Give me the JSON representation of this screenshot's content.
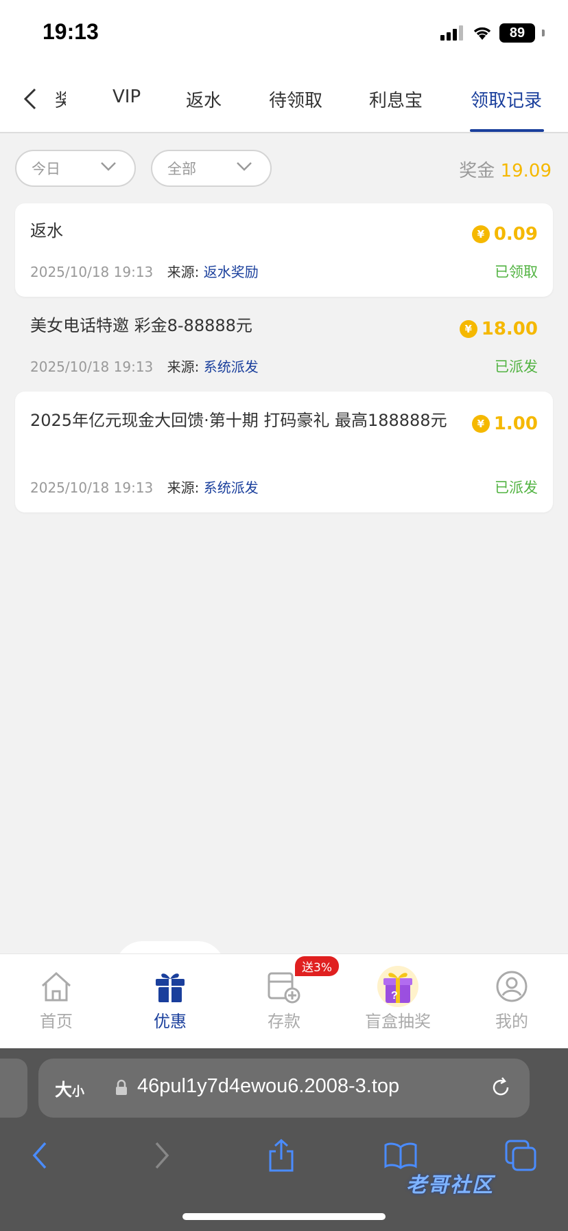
{
  "status_bar": {
    "time": "19:13",
    "battery": "89"
  },
  "tabs": {
    "items": [
      {
        "label": "奖"
      },
      {
        "label": "VIP"
      },
      {
        "label": "返水"
      },
      {
        "label": "待领取"
      },
      {
        "label": "利息宝"
      },
      {
        "label": "领取记录"
      }
    ],
    "active_index": 5
  },
  "filters": {
    "date": "今日",
    "type": "全部",
    "bonus_label": "奖金",
    "bonus_value": "19.09"
  },
  "records": [
    {
      "title": "返水",
      "amount": "0.09",
      "time": "2025/10/18 19:13",
      "source_label": "来源:",
      "source": "返水奖励",
      "status": "已领取"
    },
    {
      "title": "美女电话特邀 彩金8-88888元",
      "amount": "18.00",
      "time": "2025/10/18 19:13",
      "source_label": "来源:",
      "source": "系统派发",
      "status": "已派发"
    },
    {
      "title": "2025年亿元现金大回馈·第十期 打码豪礼 最高188888元",
      "amount": "1.00",
      "time": "2025/10/18 19:13",
      "source_label": "来源:",
      "source": "系统派发",
      "status": "已派发"
    }
  ],
  "coin_symbol": "¥",
  "bottom_nav": {
    "items": [
      {
        "label": "首页",
        "icon": "home-icon"
      },
      {
        "label": "优惠",
        "icon": "gift-icon"
      },
      {
        "label": "存款",
        "icon": "deposit-icon"
      },
      {
        "label": "盲盒抽奖",
        "icon": "mystery-box-icon"
      },
      {
        "label": "我的",
        "icon": "user-icon"
      }
    ],
    "active_index": 1,
    "deposit_badge": "送3%"
  },
  "browser": {
    "text_size": "大",
    "text_size_small": "小",
    "url": "46pul1y7d4ewou6.2008-3.top"
  },
  "watermark": "老哥社区",
  "colors": {
    "accent": "#1a3f9c",
    "gold": "#f5b800",
    "status_green": "#52b342"
  }
}
